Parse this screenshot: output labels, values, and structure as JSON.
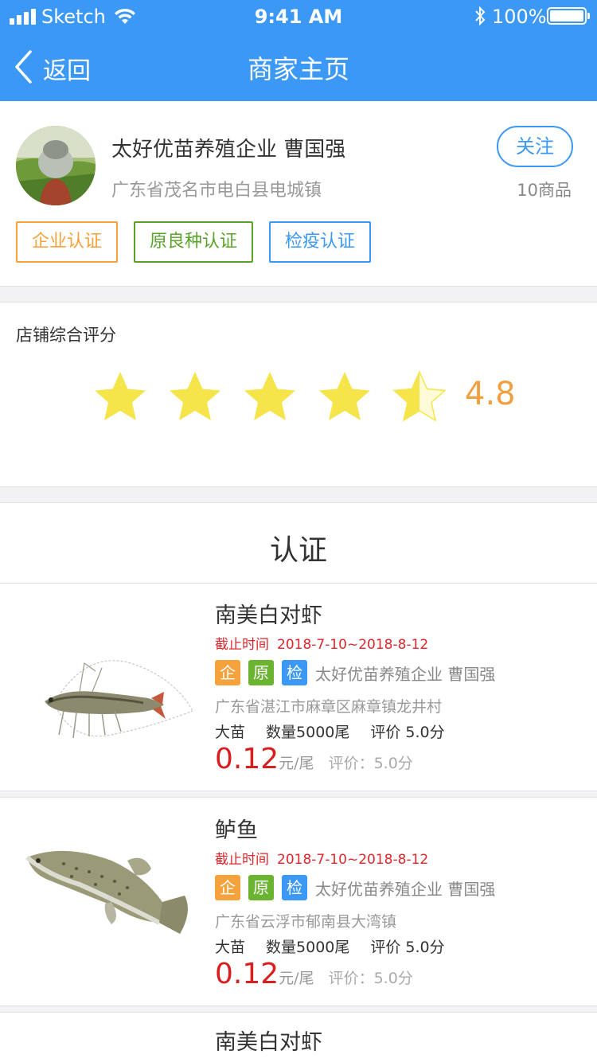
{
  "status": {
    "carrier": "Sketch",
    "time": "9:41 AM",
    "battery": "100%"
  },
  "nav": {
    "back_label": "返回",
    "title": "商家主页"
  },
  "merchant": {
    "name": "太好优苗养殖企业  曹国强",
    "address": "广东省茂名市电白县电城镇",
    "follow_label": "关注",
    "goods_count": "10商品",
    "badges": [
      "企业认证",
      "原良种认证",
      "检疫认证"
    ]
  },
  "rating": {
    "label": "店铺综合评分",
    "score": "4.8",
    "score_value": 4.8,
    "max_stars": 5,
    "star_color": "#f5e54a"
  },
  "certification": {
    "title": "认证",
    "items": [
      {
        "name": "南美白对虾",
        "date_label": "截止时间",
        "date_range": "2018-7-10~2018-8-12",
        "tags": [
          "企",
          "原",
          "检"
        ],
        "seller": "太好优苗养殖企业    曹国强",
        "address": "广东省湛江市麻章区麻章镇龙井村",
        "size": "大苗",
        "quantity": "数量5000尾",
        "score": "评价 5.0分",
        "price": "0.12",
        "price_unit": "元/尾",
        "price_rating": "评价：5.0分",
        "image_icon": "shrimp-image"
      },
      {
        "name": "鲈鱼",
        "date_label": "截止时间",
        "date_range": "2018-7-10~2018-8-12",
        "tags": [
          "企",
          "原",
          "检"
        ],
        "seller": "太好优苗养殖企业    曹国强",
        "address": "广东省云浮市郁南县大湾镇",
        "size": "大苗",
        "quantity": "数量5000尾",
        "score": "评价 5.0分",
        "price": "0.12",
        "price_unit": "元/尾",
        "price_rating": "评价：5.0分",
        "image_icon": "bass-fish-image"
      },
      {
        "name": "南美白对虾"
      }
    ]
  },
  "colors": {
    "primary": "#3b99f5",
    "orange": "#f5a23c",
    "green": "#5aa22b",
    "price_red": "#d81e1e",
    "score_orange": "#f0a040"
  }
}
